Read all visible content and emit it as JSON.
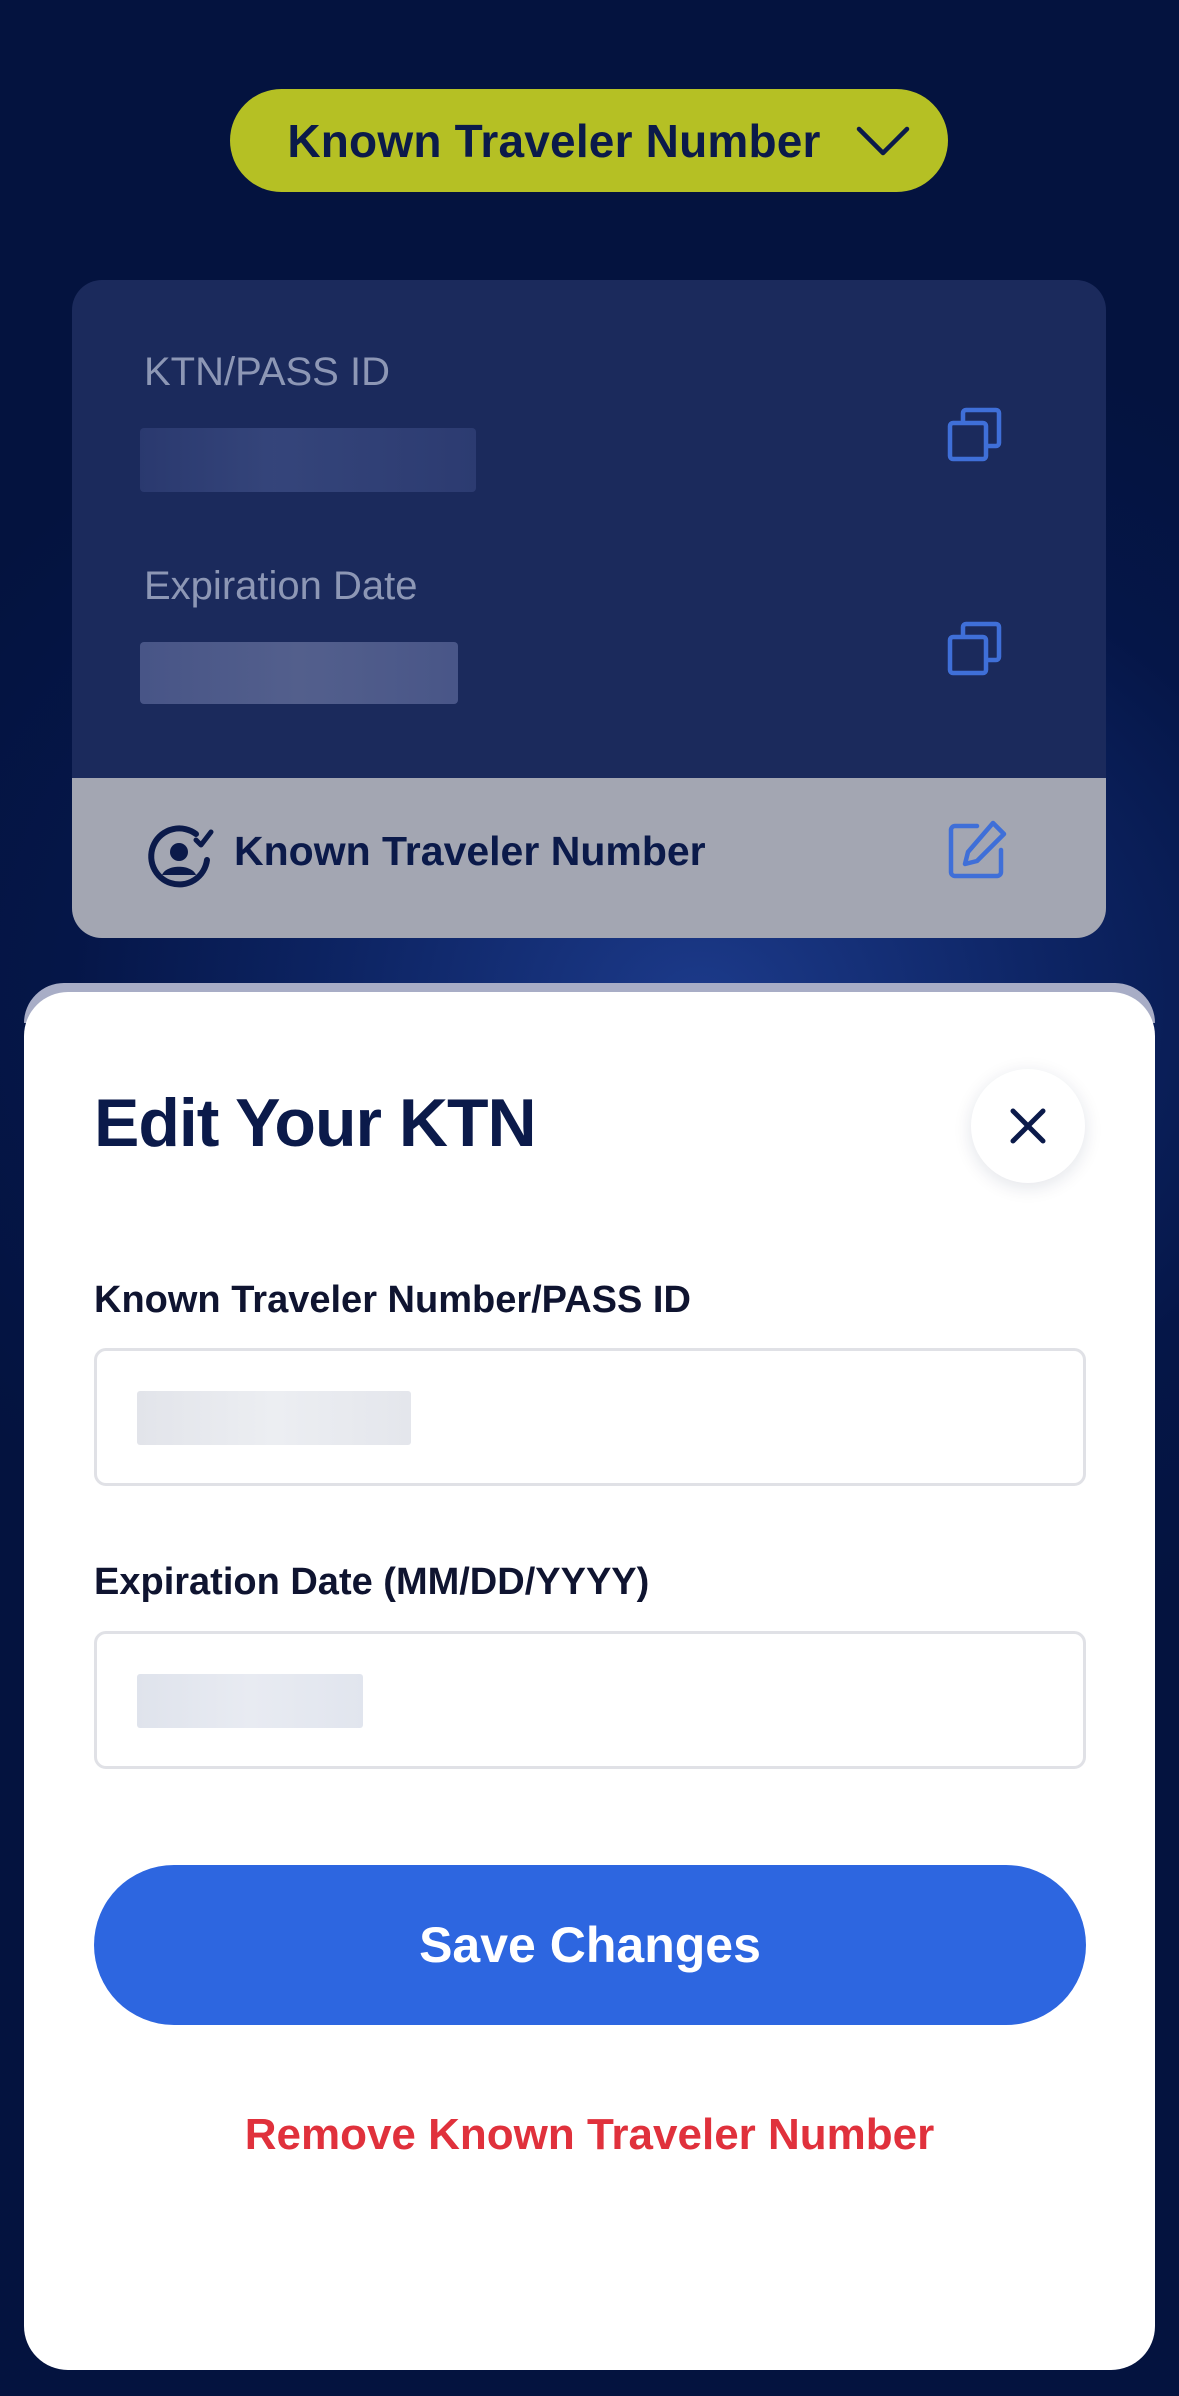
{
  "header": {
    "document_type_label": "Known Traveler Number"
  },
  "card": {
    "ktn_label": "KTN/PASS ID",
    "expiration_label": "Expiration Date",
    "footer_label": "Known Traveler Number"
  },
  "sheet": {
    "title": "Edit Your KTN",
    "ktn_field_label": "Known Traveler Number/PASS ID",
    "expiration_field_label": "Expiration Date (MM/DD/YYYY)",
    "save_label": "Save Changes",
    "remove_label": "Remove Known Traveler Number"
  },
  "icons": {
    "dropdown": "chevron-down-icon",
    "copy": "copy-icon",
    "ktn": "ktn-badge-icon",
    "edit": "edit-icon",
    "close": "close-icon"
  },
  "colors": {
    "pill": "#b5c024",
    "navy": "#0b1a4a",
    "primary_button": "#2d66e0",
    "destructive": "#e0313c",
    "icon_blue": "#3f6fd8"
  }
}
